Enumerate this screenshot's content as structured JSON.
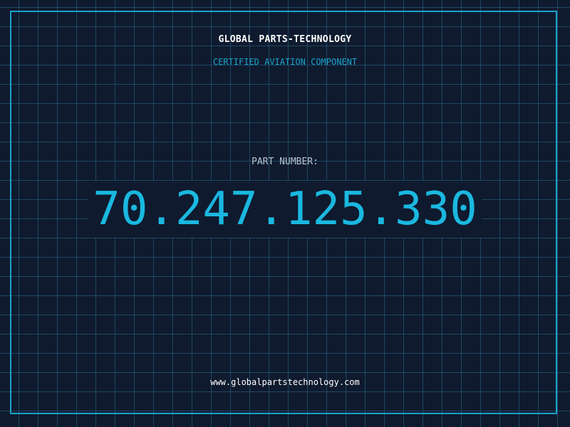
{
  "header": {
    "brand": "GLOBAL PARTS-TECHNOLOGY",
    "subtitle": "CERTIFIED AVIATION COMPONENT"
  },
  "part": {
    "label": "PART NUMBER:",
    "number": "70.247.125.330"
  },
  "footer": {
    "website": "www.globalpartstechnology.com"
  },
  "colors": {
    "background": "#0f1a2e",
    "grid": "#266e8c",
    "accent": "#1ba3cc",
    "part_number": "#1ab8e0",
    "text": "#ffffff",
    "label": "#b8c4d2"
  }
}
